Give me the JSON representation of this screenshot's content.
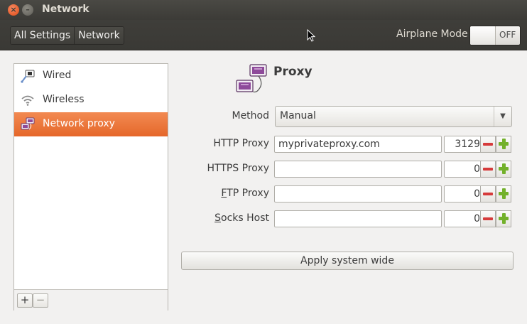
{
  "window": {
    "title": "Network",
    "close_glyph": "×",
    "minimize_glyph": "–"
  },
  "toolbar": {
    "breadcrumbs": [
      "All Settings",
      "Network"
    ],
    "airplane_label": "Airplane Mode",
    "airplane_state": "OFF"
  },
  "sidebar": {
    "items": [
      {
        "label": "Wired",
        "icon": "wired-network-icon",
        "selected": false
      },
      {
        "label": "Wireless",
        "icon": "wireless-icon",
        "selected": false
      },
      {
        "label": "Network proxy",
        "icon": "network-proxy-icon",
        "selected": true
      }
    ],
    "add_label": "+",
    "remove_label": "−"
  },
  "proxy": {
    "title": "Proxy",
    "method_label": "Method",
    "method_value": "Manual",
    "rows": [
      {
        "label": "HTTP Proxy",
        "label_pre": "",
        "label_u": "",
        "label_post": "HTTP Proxy",
        "host": "myprivateproxy.com",
        "port": "3129"
      },
      {
        "label": "HTTPS Proxy",
        "label_pre": "",
        "label_u": "",
        "label_post": "HTTPS Proxy",
        "host": "",
        "port": "0"
      },
      {
        "label": "FTP Proxy",
        "label_pre": "",
        "label_u": "F",
        "label_post": "TP Proxy",
        "host": "",
        "port": "0"
      },
      {
        "label": "Socks Host",
        "label_pre": "",
        "label_u": "S",
        "label_post": "ocks Host",
        "host": "",
        "port": "0"
      }
    ],
    "apply_label": "Apply system wide"
  },
  "colors": {
    "accent": "#e5672a",
    "titlebar": "#3c3b37",
    "minus": "#d63b3b",
    "plus": "#73b12b"
  }
}
